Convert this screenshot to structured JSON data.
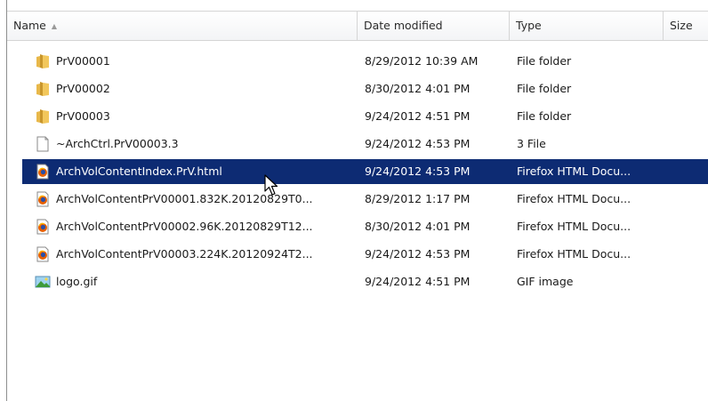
{
  "columns": {
    "name": "Name",
    "date": "Date modified",
    "type": "Type",
    "size": "Size"
  },
  "files": [
    {
      "name": "PrV00001",
      "date": "8/29/2012 10:39 AM",
      "type": "File folder",
      "icon": "folder-icon"
    },
    {
      "name": "PrV00002",
      "date": "8/30/2012 4:01 PM",
      "type": "File folder",
      "icon": "folder-icon"
    },
    {
      "name": "PrV00003",
      "date": "9/24/2012 4:51 PM",
      "type": "File folder",
      "icon": "folder-icon"
    },
    {
      "name": "~ArchCtrl.PrV00003.3",
      "date": "9/24/2012 4:53 PM",
      "type": "3 File",
      "icon": "file-icon"
    },
    {
      "name": "ArchVolContentIndex.PrV.html",
      "date": "9/24/2012 4:53 PM",
      "type": "Firefox HTML Docu...",
      "icon": "firefox-html-icon",
      "selected": true
    },
    {
      "name": "ArchVolContentPrV00001.832K.20120829T0...",
      "date": "8/29/2012 1:17 PM",
      "type": "Firefox HTML Docu...",
      "icon": "firefox-html-icon"
    },
    {
      "name": "ArchVolContentPrV00002.96K.20120829T12...",
      "date": "8/30/2012 4:01 PM",
      "type": "Firefox HTML Docu...",
      "icon": "firefox-html-icon"
    },
    {
      "name": "ArchVolContentPrV00003.224K.20120924T2...",
      "date": "9/24/2012 4:53 PM",
      "type": "Firefox HTML Docu...",
      "icon": "firefox-html-icon"
    },
    {
      "name": "logo.gif",
      "date": "9/24/2012 4:51 PM",
      "type": "GIF image",
      "icon": "image-icon"
    }
  ],
  "colors": {
    "selection": "#0d2b73",
    "folder": "#e8b84a"
  }
}
